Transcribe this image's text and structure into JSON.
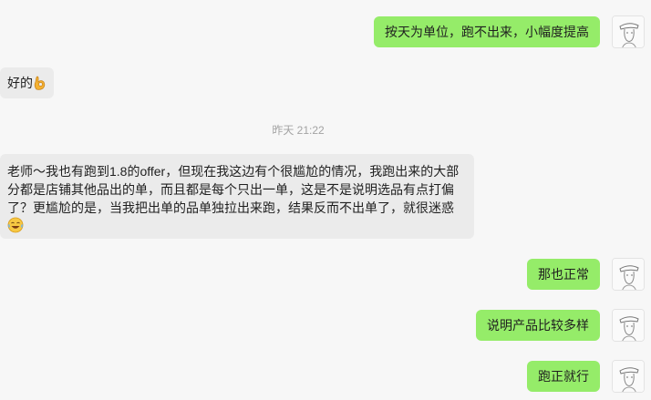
{
  "messages": [
    {
      "side": "out",
      "text": "按天为单位，跑不出来，小幅度提高"
    },
    {
      "side": "in",
      "text": "好的",
      "emoji": "ok-hand-emoji"
    },
    {
      "side": "in",
      "text": "老师～我也有跑到1.8的offer，但现在我这边有个很尴尬的情况，我跑出来的大部分都是店铺其他品出的单，而且都是每个只出一单，这是不是说明选品有点打偏了？更尴尬的是，当我把出单的品单独拉出来跑，结果反而不出单了，就很迷惑",
      "emoji": "tears-of-joy-emoji"
    },
    {
      "side": "out",
      "text": "那也正常"
    },
    {
      "side": "out",
      "text": "说明产品比较多样"
    },
    {
      "side": "out",
      "text": "跑正就行"
    }
  ],
  "timestamp": "昨天 21:22",
  "colors": {
    "outgoing": "#95ec69",
    "incoming": "#ebebeb",
    "background": "#f7f7f7",
    "timestamp": "#a3a3a3"
  }
}
